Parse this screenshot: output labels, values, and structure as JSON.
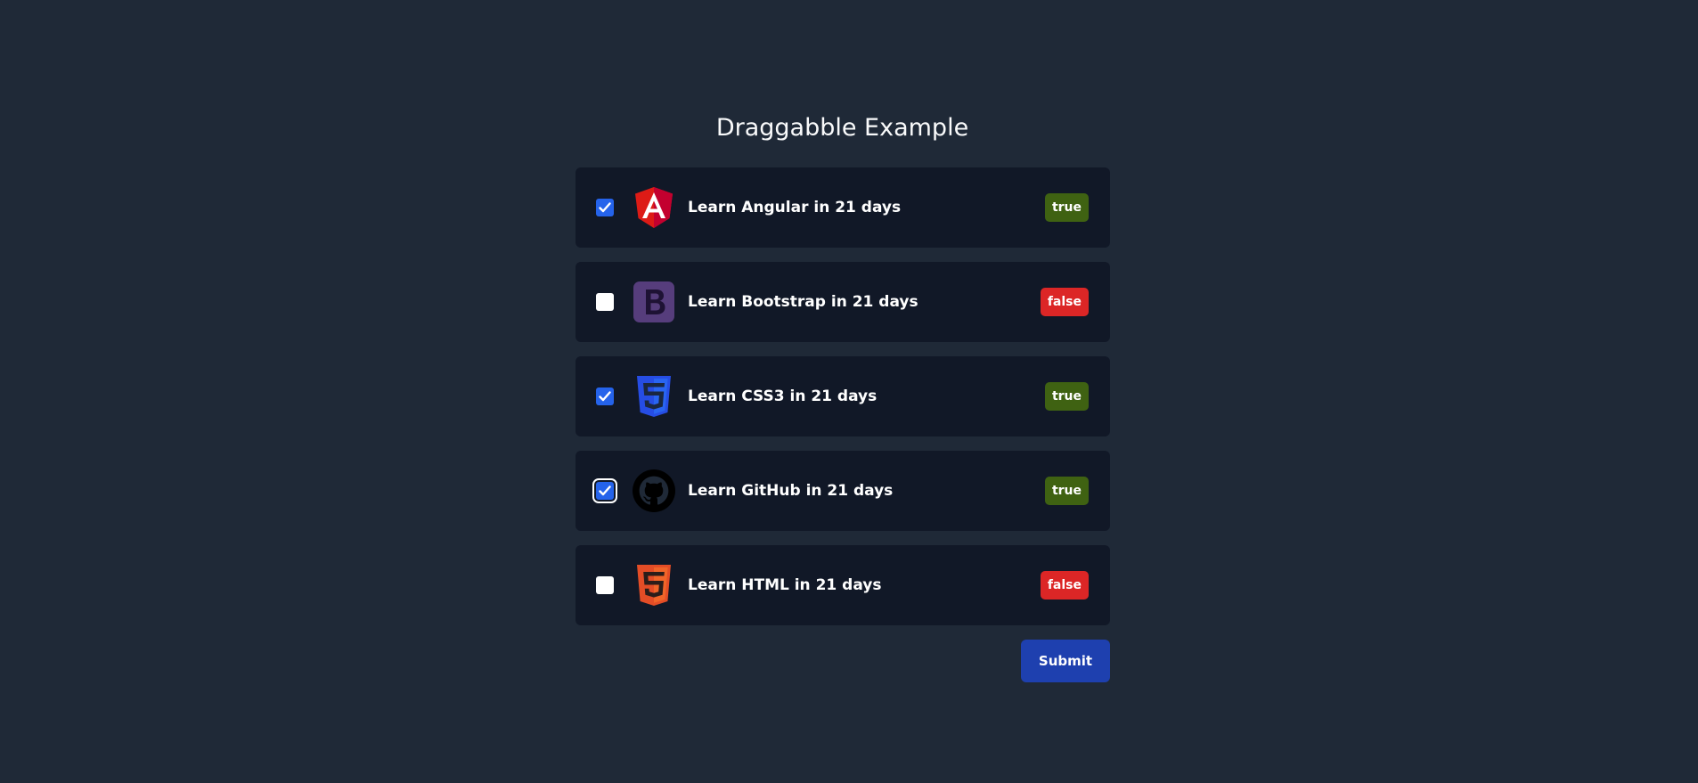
{
  "page": {
    "title": "Draggabble Example"
  },
  "items": [
    {
      "label": "Learn Angular in 21 days",
      "checked": true,
      "status": "true",
      "icon": "angular-icon"
    },
    {
      "label": "Learn Bootstrap in 21 days",
      "checked": false,
      "status": "false",
      "icon": "bootstrap-icon"
    },
    {
      "label": "Learn CSS3 in 21 days",
      "checked": true,
      "status": "true",
      "icon": "css3-icon"
    },
    {
      "label": "Learn GitHub in 21 days",
      "checked": true,
      "status": "true",
      "icon": "github-icon"
    },
    {
      "label": "Learn HTML in 21 days",
      "checked": false,
      "status": "false",
      "icon": "html5-icon"
    }
  ],
  "actions": {
    "submit_label": "Submit"
  },
  "colors": {
    "background": "#1f2937",
    "card": "#111827",
    "badge_true": "#3f6212",
    "badge_false": "#dc2626",
    "checkbox_checked": "#2563eb",
    "submit": "#1e40af"
  }
}
